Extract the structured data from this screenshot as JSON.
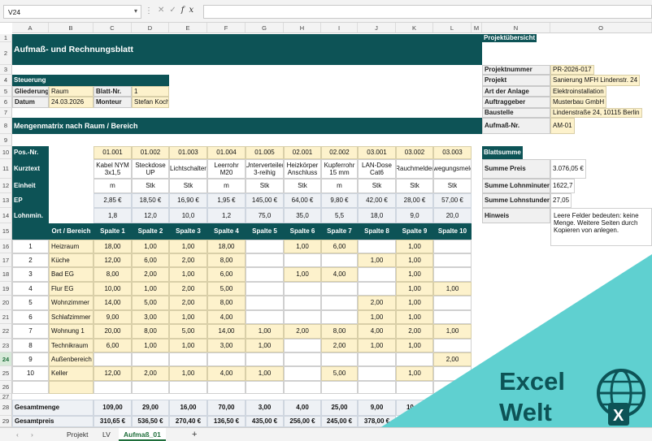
{
  "formula_bar": {
    "name_box": "V24",
    "fx": "fx",
    "formula": ""
  },
  "columns": [
    "A",
    "B",
    "C",
    "D",
    "E",
    "F",
    "G",
    "H",
    "I",
    "J",
    "K",
    "L",
    "M",
    "N",
    "O"
  ],
  "rows": [
    "1",
    "2",
    "3",
    "4",
    "5",
    "6",
    "7",
    "8",
    "9",
    "10",
    "11",
    "12",
    "13",
    "14",
    "15",
    "16",
    "17",
    "18",
    "19",
    "20",
    "21",
    "22",
    "23",
    "24",
    "25",
    "26",
    "27",
    "28",
    "29"
  ],
  "selected_row": "24",
  "title": "Aufmaß- und Rechnungsblatt",
  "steuerung": {
    "title": "Steuerung",
    "gliederung_label": "Gliederung",
    "gliederung": "Raum",
    "blatt_label": "Blatt-Nr.",
    "blatt": "1",
    "datum_label": "Datum",
    "datum": "24.03.2026",
    "monteur_label": "Monteur",
    "monteur": "Stefan Koch"
  },
  "matrix_title": "Mengenmatrix nach Raum / Bereich",
  "row_labels": {
    "pos": "Pos.-Nr.",
    "kurztext": "Kurztext",
    "einheit": "Einheit",
    "ep": "EP",
    "lohn": "Lohnmin."
  },
  "columns_data": [
    {
      "pos": "01.001",
      "kurz": "Kabel NYM 3x1,5",
      "einheit": "m",
      "ep": "2,85 €",
      "lohn": "1,8",
      "spalte": "Spalte 1",
      "menge": "109,00",
      "preis": "310,65 €"
    },
    {
      "pos": "01.002",
      "kurz": "Steckdose UP",
      "einheit": "Stk",
      "ep": "18,50 €",
      "lohn": "12,0",
      "spalte": "Spalte 2",
      "menge": "29,00",
      "preis": "536,50 €"
    },
    {
      "pos": "01.003",
      "kurz": "Lichtschalter",
      "einheit": "Stk",
      "ep": "16,90 €",
      "lohn": "10,0",
      "spalte": "Spalte 3",
      "menge": "16,00",
      "preis": "270,40 €"
    },
    {
      "pos": "01.004",
      "kurz": "Leerrohr M20",
      "einheit": "m",
      "ep": "1,95 €",
      "lohn": "1,2",
      "spalte": "Spalte 4",
      "menge": "70,00",
      "preis": "136,50 €"
    },
    {
      "pos": "01.005",
      "kurz": "Unterverteiler 3-reihig",
      "einheit": "Stk",
      "ep": "145,00 €",
      "lohn": "75,0",
      "spalte": "Spalte 5",
      "menge": "3,00",
      "preis": "435,00 €"
    },
    {
      "pos": "02.001",
      "kurz": "Heizkörper Anschluss",
      "einheit": "Stk",
      "ep": "64,00 €",
      "lohn": "35,0",
      "spalte": "Spalte 6",
      "menge": "4,00",
      "preis": "256,00 €"
    },
    {
      "pos": "02.002",
      "kurz": "Kupferrohr 15 mm",
      "einheit": "m",
      "ep": "9,80 €",
      "lohn": "5,5",
      "spalte": "Spalte 7",
      "menge": "25,00",
      "preis": "245,00 €"
    },
    {
      "pos": "03.001",
      "kurz": "LAN-Dose Cat6",
      "einheit": "Stk",
      "ep": "42,00 €",
      "lohn": "18,0",
      "spalte": "Spalte 8",
      "menge": "9,00",
      "preis": "378,00 €"
    },
    {
      "pos": "03.002",
      "kurz": "Rauchmelder",
      "einheit": "Stk",
      "ep": "28,00 €",
      "lohn": "9,0",
      "spalte": "Spalte 9",
      "menge": "10,00",
      "preis": ""
    },
    {
      "pos": "03.003",
      "kurz": "Bewegungsmelder",
      "einheit": "Stk",
      "ep": "57,00 €",
      "lohn": "20,0",
      "spalte": "Spalte 10",
      "menge": "",
      "preis": ""
    }
  ],
  "ort_header": "Ort / Bereich",
  "data_rows": [
    {
      "nr": "1",
      "ort": "Heizraum",
      "v": [
        "18,00",
        "1,00",
        "1,00",
        "18,00",
        "",
        "1,00",
        "6,00",
        "",
        "1,00",
        ""
      ]
    },
    {
      "nr": "2",
      "ort": "Küche",
      "v": [
        "12,00",
        "6,00",
        "2,00",
        "8,00",
        "",
        "",
        "",
        "1,00",
        "1,00",
        ""
      ]
    },
    {
      "nr": "3",
      "ort": "Bad EG",
      "v": [
        "8,00",
        "2,00",
        "1,00",
        "6,00",
        "",
        "1,00",
        "4,00",
        "",
        "1,00",
        ""
      ]
    },
    {
      "nr": "4",
      "ort": "Flur EG",
      "v": [
        "10,00",
        "1,00",
        "2,00",
        "5,00",
        "",
        "",
        "",
        "",
        "1,00",
        "1,00"
      ]
    },
    {
      "nr": "5",
      "ort": "Wohnzimmer",
      "v": [
        "14,00",
        "5,00",
        "2,00",
        "8,00",
        "",
        "",
        "",
        "2,00",
        "1,00",
        ""
      ]
    },
    {
      "nr": "6",
      "ort": "Schlafzimmer",
      "v": [
        "9,00",
        "3,00",
        "1,00",
        "4,00",
        "",
        "",
        "",
        "1,00",
        "1,00",
        ""
      ]
    },
    {
      "nr": "7",
      "ort": "Wohnung 1",
      "v": [
        "20,00",
        "8,00",
        "5,00",
        "14,00",
        "1,00",
        "2,00",
        "8,00",
        "4,00",
        "2,00",
        "1,00"
      ]
    },
    {
      "nr": "8",
      "ort": "Technikraum",
      "v": [
        "6,00",
        "1,00",
        "1,00",
        "3,00",
        "1,00",
        "",
        "2,00",
        "1,00",
        "1,00",
        ""
      ]
    },
    {
      "nr": "9",
      "ort": "Außenbereich",
      "v": [
        "",
        "",
        "",
        "",
        "",
        "",
        "",
        "",
        "",
        "2,00"
      ]
    },
    {
      "nr": "10",
      "ort": "Keller",
      "v": [
        "12,00",
        "2,00",
        "1,00",
        "4,00",
        "1,00",
        "",
        "5,00",
        "",
        "1,00",
        ""
      ]
    }
  ],
  "totals": {
    "menge_label": "Gesamtmenge",
    "preis_label": "Gesamtpreis"
  },
  "projekt": {
    "title": "Projektübersicht",
    "items": [
      {
        "label": "Projektnummer",
        "value": "PR-2026-017"
      },
      {
        "label": "Projekt",
        "value": "Sanierung MFH Lindenstr. 24"
      },
      {
        "label": "Art der Anlage",
        "value": "Elektroinstallation"
      },
      {
        "label": "Auftraggeber",
        "value": "Musterbau GmbH"
      },
      {
        "label": "Baustelle",
        "value": "Lindenstraße 24, 10115 Berlin"
      },
      {
        "label": "Aufmaß-Nr.",
        "value": "AM-01"
      }
    ]
  },
  "blattsumme": {
    "title": "Blattsumme",
    "items": [
      {
        "label": "Summe Preis",
        "value": "3.076,05 €"
      },
      {
        "label": "Summe Lohnminuten",
        "value": "1622,7"
      },
      {
        "label": "Summe Lohnstunden",
        "value": "27,05"
      },
      {
        "label": "Hinweis",
        "value": ""
      }
    ],
    "hint": "Leere Felder bedeuten: keine Menge. Weitere Seiten durch Kopieren von anlegen."
  },
  "tabs": [
    "Projekt",
    "LV",
    "Aufmaß_01"
  ],
  "active_tab": "Aufmaß_01",
  "add_tab": "+",
  "logo": {
    "line1": "Excel",
    "line2": "Welt",
    "badge": "X",
    "colors": {
      "triangle": "#5fd0d0",
      "text": "#0d5356"
    }
  },
  "colors": {
    "header_teal": "#0d5356",
    "input_yellow": "#fdf2cc",
    "grid": "#d0d0d0"
  }
}
